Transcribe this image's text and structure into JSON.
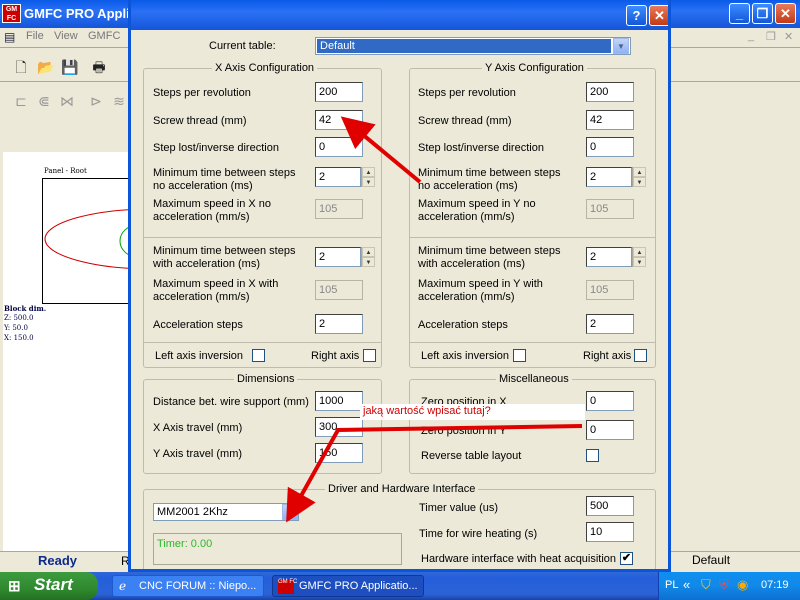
{
  "app": {
    "title": "GMFC PRO Applic",
    "logo": "GM FC",
    "menu": [
      "File",
      "View",
      "GMFC"
    ],
    "status": {
      "ready": "Ready",
      "left_char": "R",
      "right": "Default"
    },
    "canvas": {
      "panel_label": "Panel - Root",
      "block_title": "Block dim.",
      "block_z": "Z: 500.0",
      "block_y": "Y: 50.0",
      "block_x": "X: 150.0"
    }
  },
  "dialog": {
    "current_table_label": "Current table:",
    "current_table_value": "Default",
    "x_axis": {
      "title": "X Axis Configuration",
      "steps_label": "Steps per revolution",
      "steps": "200",
      "screw_label": "Screw thread (mm)",
      "screw": "42",
      "lost_label": "Step lost/inverse direction",
      "lost": "0",
      "min_noacc_label1": "Minimum time between steps",
      "min_noacc_label2": "no acceleration (ms)",
      "min_noacc": "2",
      "max_noacc_label1": "Maximum speed in X no",
      "max_noacc_label2": "acceleration (mm/s)",
      "max_noacc": "105",
      "min_acc_label1": "Minimum time between steps",
      "min_acc_label2": "with acceleration (ms)",
      "min_acc": "2",
      "max_acc_label1": "Maximum speed in X with",
      "max_acc_label2": "acceleration (mm/s)",
      "max_acc": "105",
      "acc_steps_label": "Acceleration steps",
      "acc_steps": "2",
      "left_inv_label": "Left axis inversion",
      "right_label": "Right axis"
    },
    "y_axis": {
      "title": "Y Axis Configuration",
      "steps_label": "Steps per revolution",
      "steps": "200",
      "screw_label": "Screw thread (mm)",
      "screw": "42",
      "lost_label": "Step lost/inverse direction",
      "lost": "0",
      "min_noacc_label1": "Minimum time between steps",
      "min_noacc_label2": "no acceleration (ms)",
      "min_noacc": "2",
      "max_noacc_label1": "Maximum speed in Y no",
      "max_noacc_label2": "acceleration (mm/s)",
      "max_noacc": "105",
      "min_acc_label1": "Minimum time between steps",
      "min_acc_label2": "with acceleration (ms)",
      "min_acc": "2",
      "max_acc_label1": "Maximum speed in Y with",
      "max_acc_label2": "acceleration (mm/s)",
      "max_acc": "105",
      "acc_steps_label": "Acceleration steps",
      "acc_steps": "2",
      "left_inv_label": "Left axis inversion",
      "right_label": "Right axis"
    },
    "dimensions": {
      "title": "Dimensions",
      "dist_label": "Distance bet. wire support (mm)",
      "dist": "1000",
      "x_travel_label": "X Axis travel (mm)",
      "x_travel": "300",
      "y_travel_label": "Y Axis travel (mm)",
      "y_travel": "150"
    },
    "misc": {
      "title": "Miscellaneous",
      "zero_x_label": "Zero position in X",
      "zero_x": "0",
      "zero_y_label": "Zero position in Y",
      "zero_y": "0",
      "reverse_label": "Reverse table layout"
    },
    "driver": {
      "title": "Driver and Hardware Interface",
      "driver_value": "MM2001 2Khz",
      "timer_display": "Timer: 0.00",
      "timer_label": "Timer value (us)",
      "timer": "500",
      "heat_label": "Time for wire heating (s)",
      "heat": "10",
      "hw_label": "Hardware interface with heat acquisition",
      "hw_checked": "✔"
    },
    "annotation": "jaką wartość wpisać tutaj?"
  },
  "taskbar": {
    "start": "Start",
    "task1": "CNC FORUM :: Niepo...",
    "task2": "GMFC PRO Applicatio...",
    "lang": "PL",
    "clock": "07:19"
  },
  "colors": {
    "title_blue": "#0a5ae8",
    "annotation_red": "#e00000",
    "selection": "#316ac5",
    "panel_curve_red": "#d00000",
    "panel_curve_green": "#00a000"
  }
}
